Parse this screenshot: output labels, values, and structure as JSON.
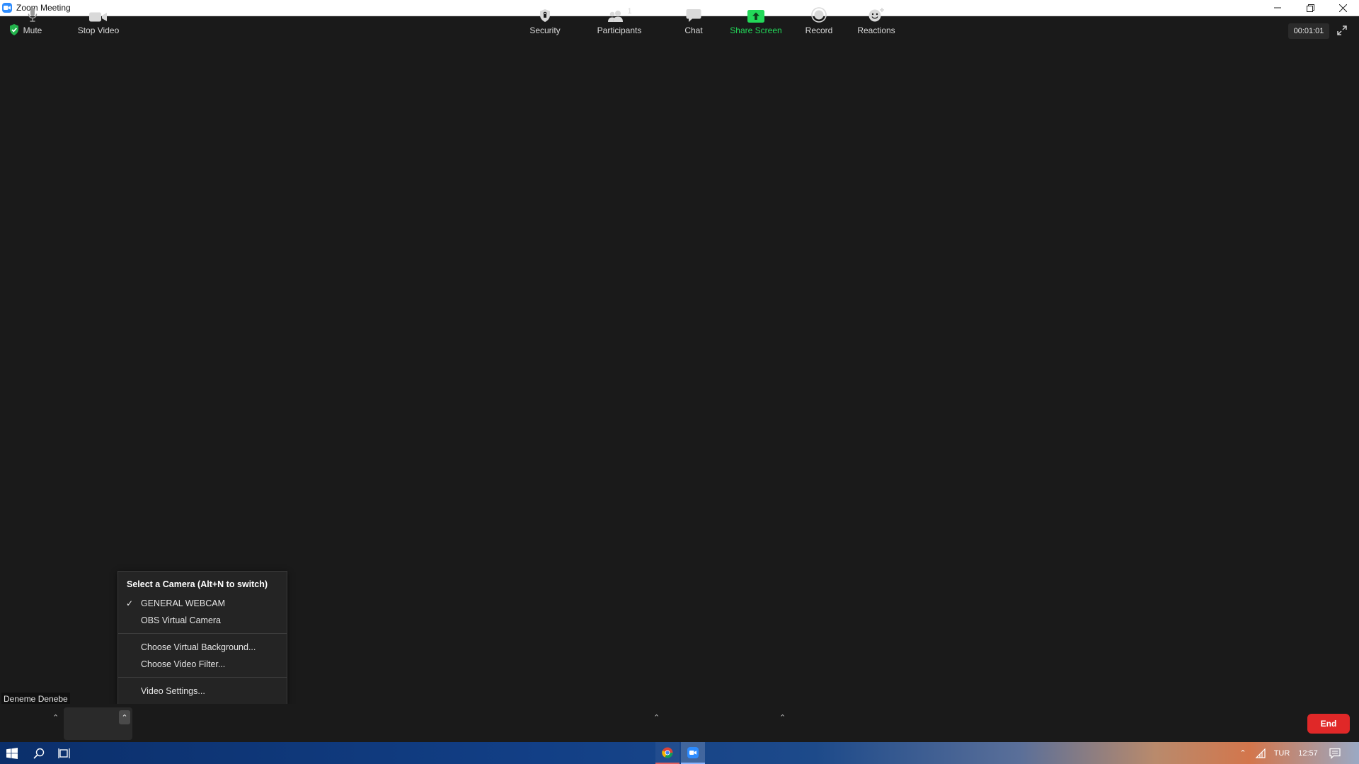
{
  "window": {
    "title": "Zoom Meeting",
    "controls": [
      "minimize",
      "restore",
      "close"
    ]
  },
  "meeting": {
    "timer": "00:01:01",
    "participant_name": "Deneme Denebe",
    "encryption_icon": "shield-check-icon"
  },
  "camera_menu": {
    "title": "Select a Camera (Alt+N to switch)",
    "cameras": [
      {
        "label": "GENERAL WEBCAM",
        "selected": true
      },
      {
        "label": "OBS Virtual Camera",
        "selected": false
      }
    ],
    "options": [
      "Choose Virtual Background...",
      "Choose Video Filter..."
    ],
    "settings": "Video Settings..."
  },
  "toolbar": {
    "mute": "Mute",
    "stop_video": "Stop Video",
    "security": "Security",
    "participants": "Participants",
    "participants_count": "1",
    "chat": "Chat",
    "share_screen": "Share Screen",
    "record": "Record",
    "reactions": "Reactions",
    "end": "End",
    "colors": {
      "share_green": "#23d959",
      "end_red": "#e02828"
    }
  },
  "taskbar": {
    "language": "TUR",
    "time": "12:57"
  }
}
